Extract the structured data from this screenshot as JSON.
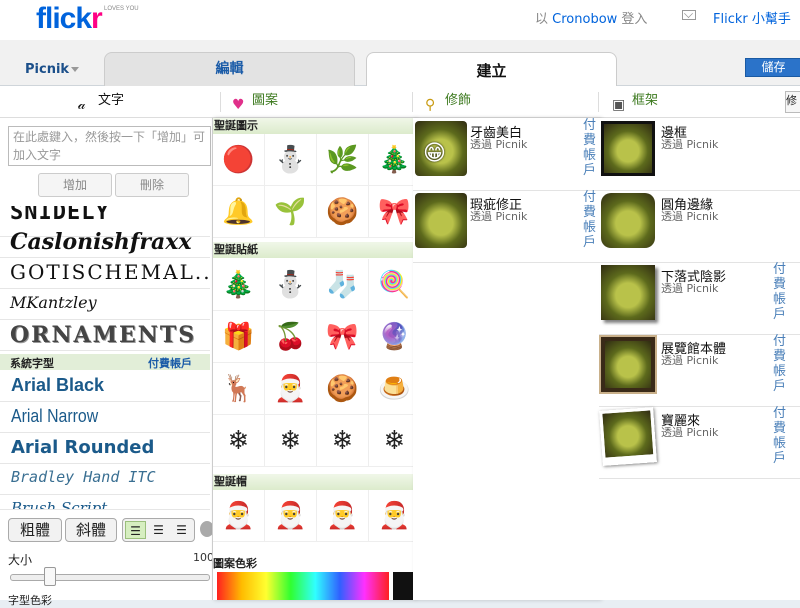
{
  "header": {
    "logo_left": "flick",
    "logo_right": "r",
    "logo_tag": "LOVES YOU",
    "signin_prefix": "以",
    "signin_user": "Cronobow",
    "signin_suffix": "登入",
    "helper": "Flickr 小幫手"
  },
  "tabs": {
    "app": "Picnik",
    "edit": "編輯",
    "create": "建立",
    "save": "儲存"
  },
  "subtabs": {
    "text": "文字",
    "stamp": "圖案",
    "deco": "修飾",
    "frame": "框架",
    "more": "修"
  },
  "text_panel": {
    "placeholder": "在此處鍵入，然後按一下「增加」可加入文字",
    "add": "增加",
    "delete": "刪除",
    "fonts": [
      "SNIDELY",
      "Caslonishfraxx",
      "GOTISCHEMAL...",
      "MKantzley",
      "ORNAMENTS"
    ],
    "system_fonts_label": "系統字型",
    "paid_label": "付費帳戶",
    "system_fonts": [
      "Arial Black",
      "Arial Narrow",
      "Arial Rounded",
      "Bradley Hand ITC",
      "Brush Script"
    ],
    "bold": "粗體",
    "italic": "斜體",
    "size_label": "大小",
    "size_value": "100",
    "next_section": "字型色彩"
  },
  "stamp_panel": {
    "groups": [
      {
        "title": "聖誕圖示",
        "icons": [
          "🔴",
          "⛄",
          "🌿",
          "🎄",
          "🔔",
          "🌱",
          "🍪",
          "🎀"
        ]
      },
      {
        "title": "聖誕貼紙",
        "icons": [
          "🎄",
          "⛄",
          "🧦",
          "🍭",
          "🎁",
          "🍒",
          "🎀",
          "🔮",
          "🦌",
          "🎅",
          "🍪",
          "🍮",
          "❄",
          "❄",
          "❄",
          "❄"
        ]
      },
      {
        "title": "聖誕帽",
        "icons": [
          "🎅",
          "🎅",
          "🎅",
          "🎅"
        ]
      }
    ],
    "palette_label": "圖案色彩"
  },
  "deco_panel": {
    "via": "透過 Picnik",
    "pay": "付費帳戶",
    "items": [
      "牙齒美白",
      "瑕疵修正"
    ]
  },
  "frame_panel": {
    "via": "透過 Picnik",
    "pay": "付費帳戶",
    "items": [
      "邊框",
      "圓角邊緣",
      "下落式陰影",
      "展覽館本體",
      "寶麗來"
    ]
  }
}
